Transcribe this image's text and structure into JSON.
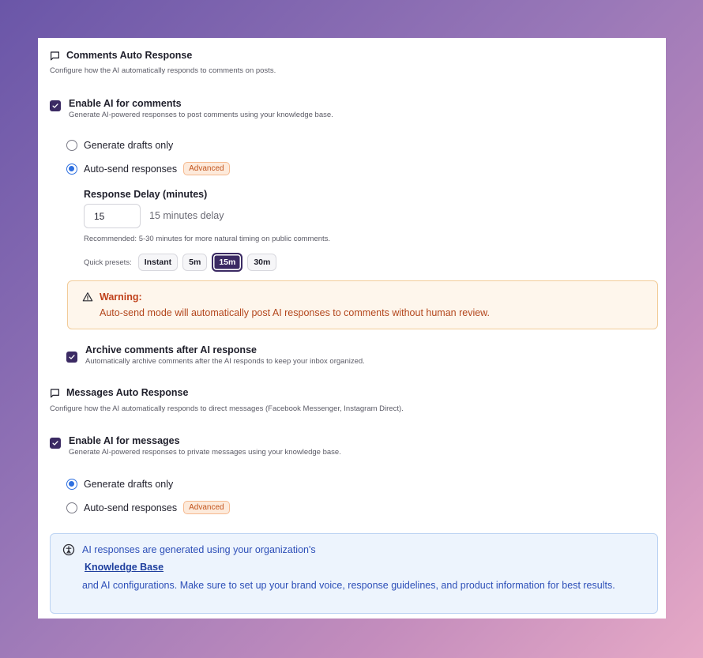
{
  "comments": {
    "title": "Comments Auto Response",
    "description": "Configure how the AI automatically responds to comments on posts.",
    "enable_title": "Enable AI for comments",
    "enable_desc": "Generate AI-powered responses to post comments using your knowledge base.",
    "enable_checked": true,
    "radio_drafts": "Generate drafts only",
    "radio_auto": "Auto-send responses",
    "selected": "auto",
    "badge": "Advanced",
    "delay_label": "Response Delay (minutes)",
    "delay_value": "15",
    "delay_note": "15 minutes delay",
    "recommendation": "Recommended: 5-30 minutes for more natural timing on public comments.",
    "presets_label": "Quick presets:",
    "presets": [
      "Instant",
      "5m",
      "15m",
      "30m"
    ],
    "active_preset": "15m",
    "warning_title": "Warning:",
    "warning_text": "Auto-send mode will automatically post AI responses to comments without human review.",
    "archive_title": "Archive comments after AI response",
    "archive_desc": "Automatically archive comments after the AI responds to keep your inbox organized.",
    "archive_checked": true
  },
  "messages": {
    "title": "Messages Auto Response",
    "description": "Configure how the AI automatically responds to direct messages (Facebook Messenger, Instagram Direct).",
    "enable_title": "Enable AI for messages",
    "enable_desc": "Generate AI-powered responses to private messages using your knowledge base.",
    "enable_checked": true,
    "radio_drafts": "Generate drafts only",
    "radio_auto": "Auto-send responses",
    "selected": "drafts",
    "badge": "Advanced"
  },
  "info": {
    "line1": "AI responses are generated using your organization's",
    "link": "Knowledge Base",
    "line3": "and AI configurations. Make sure to set up your brand voice, response guidelines, and product information for best results."
  },
  "colors": {
    "accent": "#3b2a63",
    "radio": "#2d6fe0",
    "warning": "#c0411b",
    "info": "#2d4fb8"
  }
}
